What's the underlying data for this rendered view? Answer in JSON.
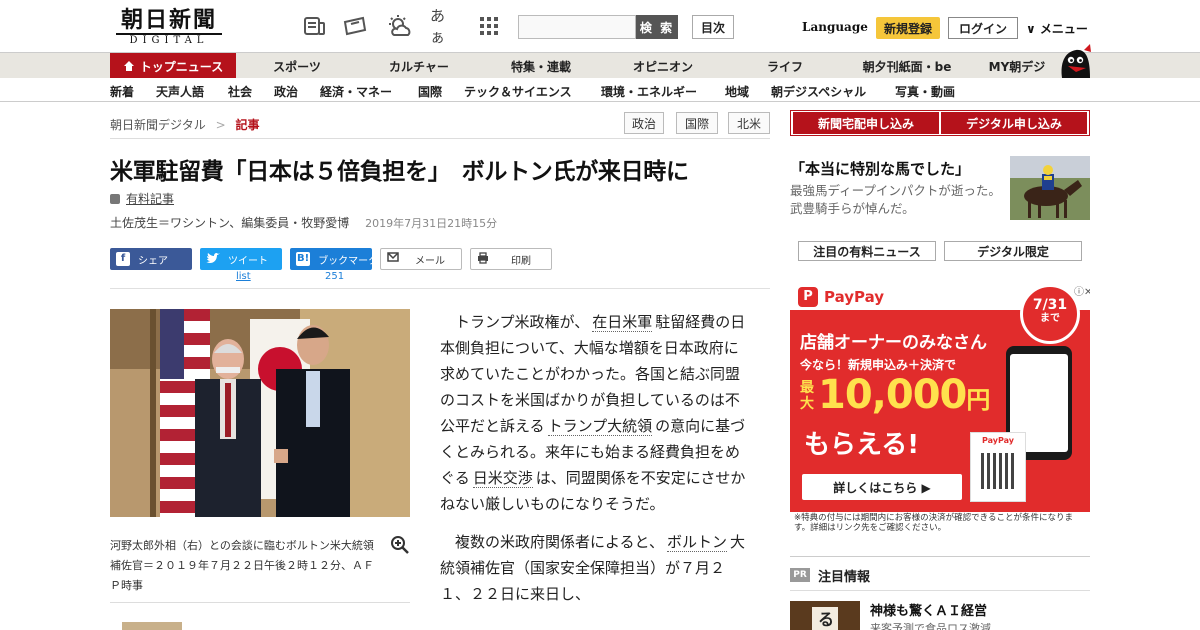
{
  "header": {
    "logo_main": "朝日新聞",
    "logo_sub": "DIGITAL",
    "font_size_label": "あぁ",
    "search_button": "検 索",
    "search_placeholder": "",
    "contents_button": "目次",
    "language": "Language",
    "register": "新規登録",
    "login": "ログイン",
    "menu": "∨ メニュー"
  },
  "nav_primary": [
    "トップニュース",
    "スポーツ",
    "カルチャー",
    "特集・連載",
    "オピニオン",
    "ライフ",
    "朝夕刊紙面・be",
    "MY朝デジ"
  ],
  "nav_secondary": [
    "新着",
    "天声人語",
    "社会",
    "政治",
    "経済・マネー",
    "国際",
    "テック＆サイエンス",
    "環境・エネルギー",
    "地域",
    "朝デジスペシャル",
    "写真・動画"
  ],
  "breadcrumb": {
    "home": "朝日新聞デジタル",
    "sep": ">",
    "current": "記事"
  },
  "tags": [
    "政治",
    "国際",
    "北米"
  ],
  "article": {
    "headline": "米軍駐留費「日本は５倍負担を」　ボルトン氏が来日時に",
    "paid_label": "有料記事",
    "byline": "土佐茂生＝ワシントン、編集委員・牧野愛博",
    "date": "2019年7月31日21時15分",
    "share": {
      "facebook": "シェア",
      "twitter": "ツイート",
      "twitter_count": "list",
      "hatena": "ブックマーク",
      "hatena_count": "251",
      "mail": "メール",
      "print": "印刷"
    },
    "caption": "河野太郎外相（右）との会談に臨むボルトン米大統領補佐官＝２０１９年７月２２日午後２時１２分、ＡＦＰ時事",
    "p1": {
      "a": "トランプ米政権が、",
      "link1": "在日米軍",
      "b": "駐留経費の日本側負担について、大幅な増額を日本政府に求めていたことがわかった。各国と結ぶ同盟のコストを米国ばかりが負担しているのは不公平だと訴える",
      "link2": "トランプ大統領",
      "c": "の意向に基づくとみられる。来年にも始まる経費負担をめぐる",
      "link3": "日米交渉",
      "d": "は、同盟関係を不安定にさせかねない厳しいものになりそうだ。"
    },
    "p2": {
      "a": "複数の米政府関係者によると、",
      "link1": "ボルトン",
      "b": "大統領補佐官（国家安全保障担当）が７月２１、２２日に来日し、"
    }
  },
  "sidebar": {
    "buttons": [
      "新聞宅配申し込み",
      "デジタル申し込み"
    ],
    "story_title": "「本当に特別な馬でした」",
    "story_sub": "最強馬ディープインパクトが逝った。武豊騎手らが悼んだ。",
    "tabs": [
      "注目の有料ニュース",
      "デジタル限定"
    ],
    "ad": {
      "brand": "PayPay",
      "badge_date": "7/31",
      "badge_suffix": "まで",
      "line1": "店舗オーナーのみなさん",
      "line2": "今なら！新規申込み＋決済で",
      "max_label": "最大",
      "amount": "10,000",
      "yen": "円",
      "get": "もらえる!",
      "cta": "詳しくはこちら ▶",
      "card_brand": "PayPay",
      "footnote": "※特典の付与には期間内にお客様の決済が確認できることが条件になります。詳細はリンク先をご確認ください。"
    },
    "pr": {
      "badge": "PR",
      "title": "注目情報",
      "item_title": "神様も驚くＡＩ経営",
      "item_sub": "来客予測で食品ロス激減"
    }
  },
  "colors": {
    "brand_red": "#b5121b",
    "nav_bg": "#e8e6e0",
    "paypay_red": "#e12c2c"
  }
}
